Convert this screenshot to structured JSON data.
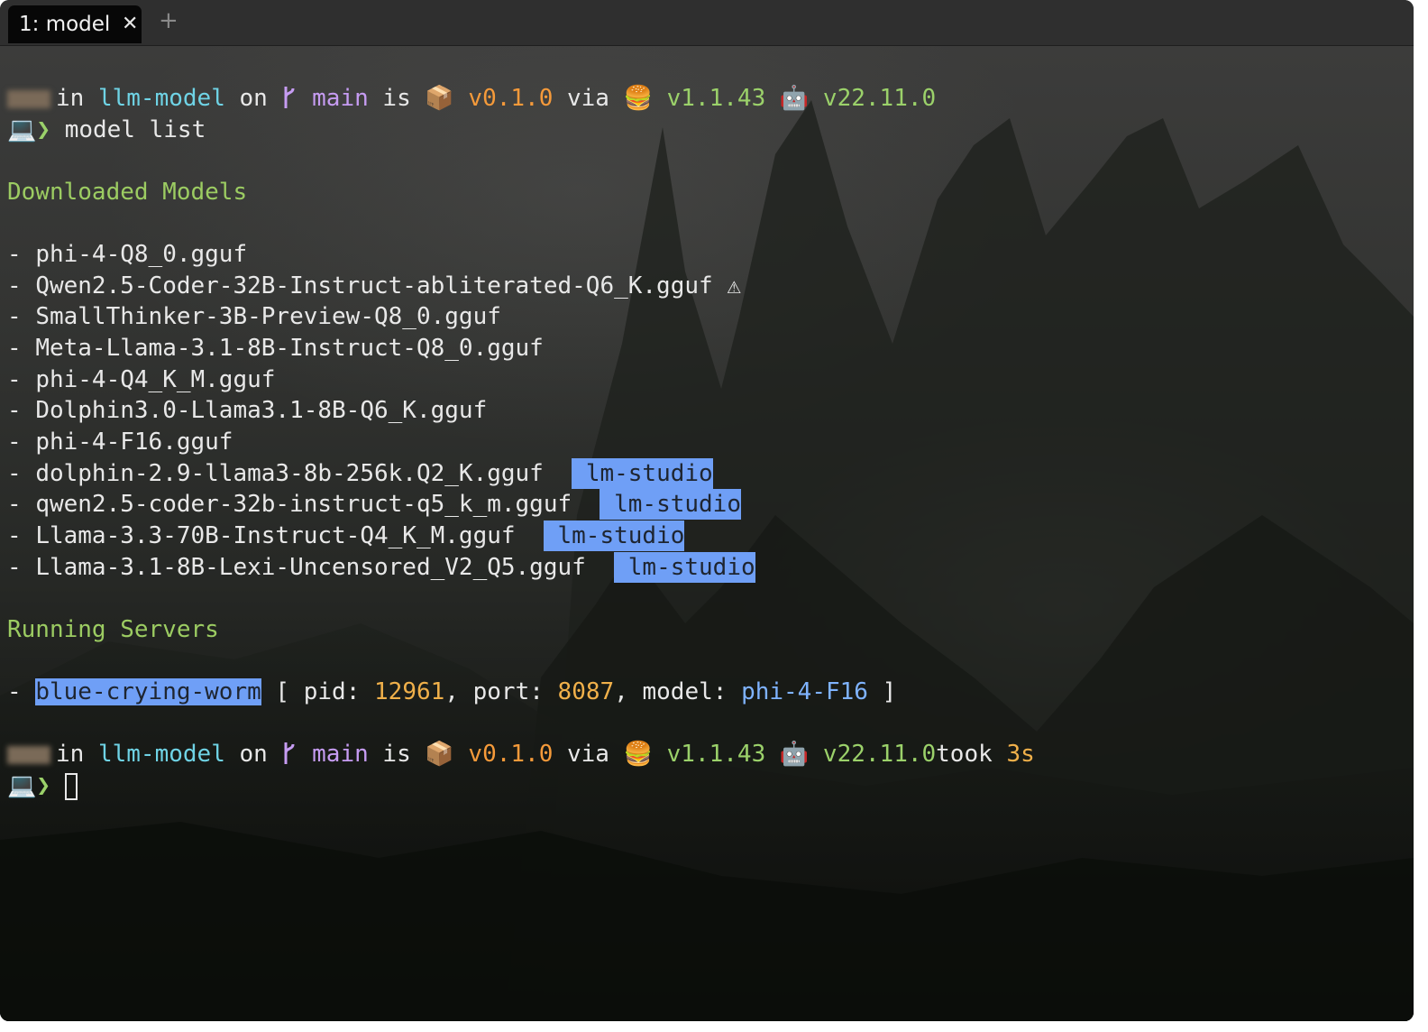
{
  "tab": {
    "title": "1: model",
    "close_glyph": "✕",
    "new_glyph": "+"
  },
  "prompt": {
    "in": "in",
    "dir": "llm-model",
    "on": "on",
    "branch_icon": "git-branch-icon",
    "branch": "main",
    "is": "is",
    "package_icon": "📦",
    "pkg_version": "v0.1.0",
    "via": "via",
    "bun_icon": "🍔",
    "bun_version": "v1.1.43",
    "node_icon": "🤖",
    "node_version": "v22.11.0",
    "laptop_icon": "💻",
    "arrow": "❯"
  },
  "command": "model list",
  "downloaded_heading": "Downloaded Models",
  "models": [
    {
      "name": "phi-4-Q8_0.gguf",
      "tag": ""
    },
    {
      "name": "Qwen2.5-Coder-32B-Instruct-abliterated-Q6_K.gguf",
      "tag": "",
      "warn": "⚠"
    },
    {
      "name": "SmallThinker-3B-Preview-Q8_0.gguf",
      "tag": ""
    },
    {
      "name": "Meta-Llama-3.1-8B-Instruct-Q8_0.gguf",
      "tag": ""
    },
    {
      "name": "phi-4-Q4_K_M.gguf",
      "tag": ""
    },
    {
      "name": "Dolphin3.0-Llama3.1-8B-Q6_K.gguf",
      "tag": ""
    },
    {
      "name": "phi-4-F16.gguf",
      "tag": ""
    },
    {
      "name": "dolphin-2.9-llama3-8b-256k.Q2_K.gguf",
      "tag": "lm-studio"
    },
    {
      "name": "qwen2.5-coder-32b-instruct-q5_k_m.gguf",
      "tag": "lm-studio"
    },
    {
      "name": "Llama-3.3-70B-Instruct-Q4_K_M.gguf",
      "tag": "lm-studio"
    },
    {
      "name": "Llama-3.1-8B-Lexi-Uncensored_V2_Q5.gguf",
      "tag": "lm-studio"
    }
  ],
  "servers_heading": "Running Servers",
  "server": {
    "name": "blue-crying-worm",
    "open": "[",
    "pid_label": "pid:",
    "pid": "12961",
    "port_label": "port:",
    "port": "8087",
    "model_label": "model:",
    "model": "phi-4-F16",
    "close": "]"
  },
  "took": {
    "label": "took",
    "value": "3s"
  },
  "dash": "-",
  "colors": {
    "highlight": "#6f9ff6",
    "cyan": "#6fd3e5",
    "purple": "#c69cf2",
    "orange": "#f59a3a",
    "green": "#9bd16a"
  }
}
